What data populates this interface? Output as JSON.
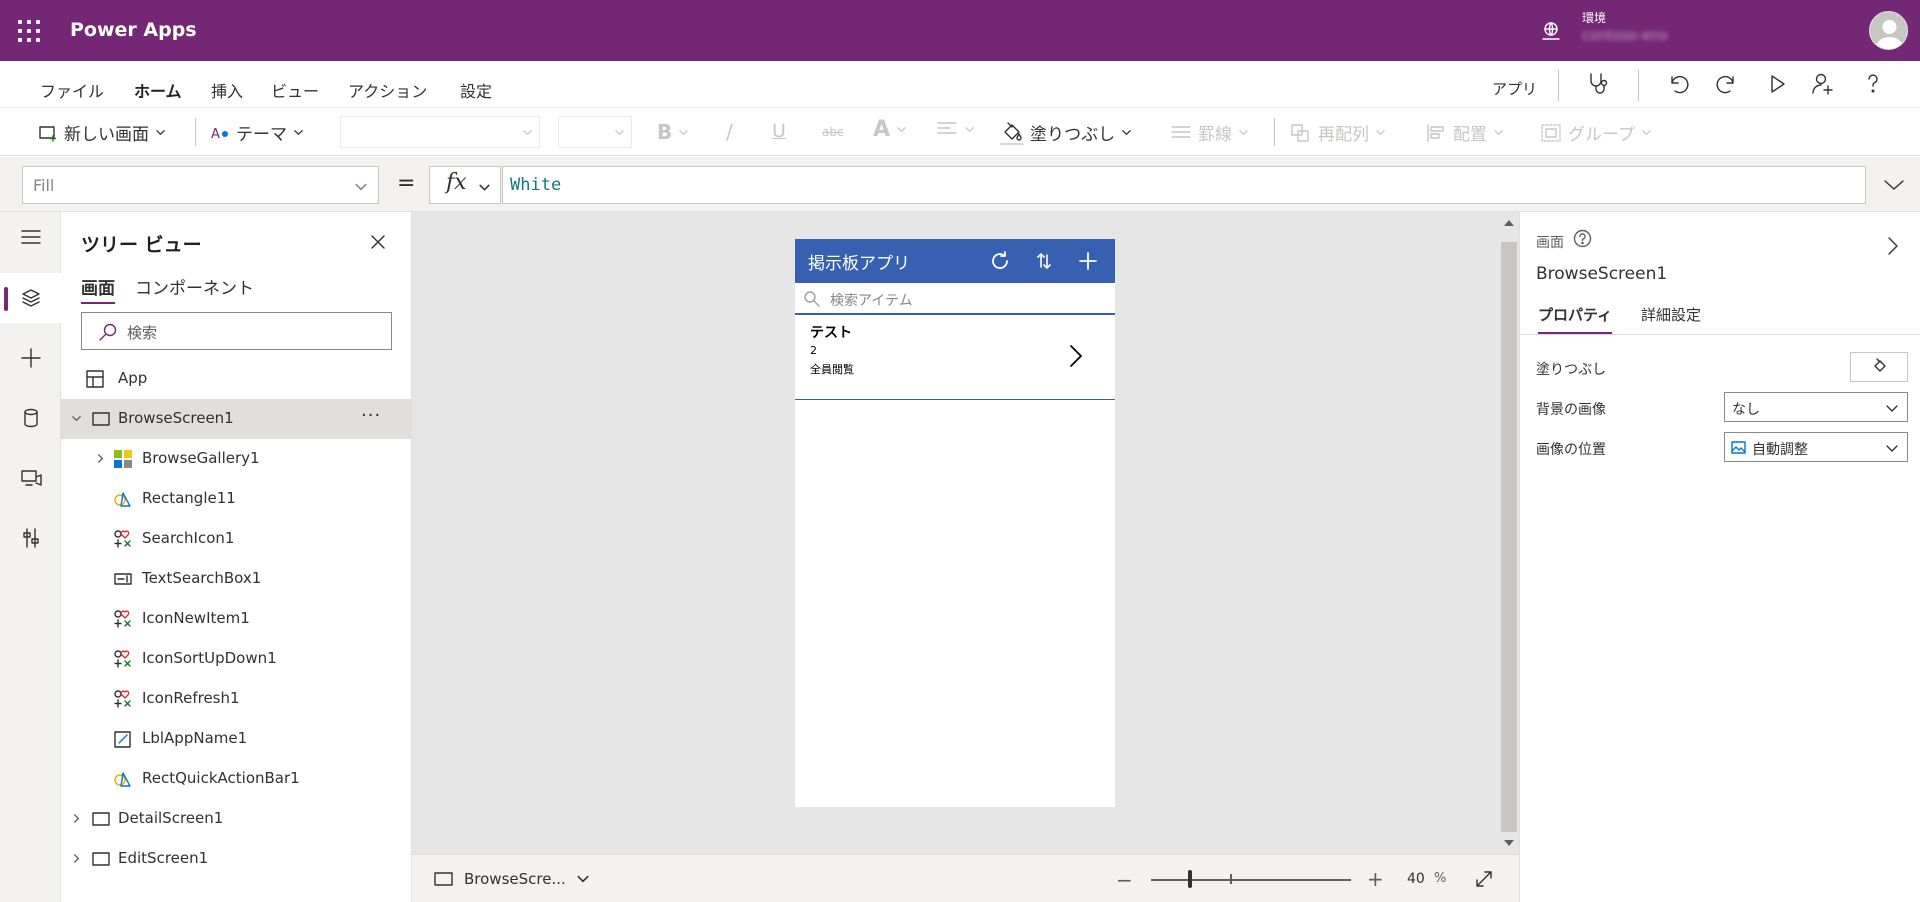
{
  "topbar": {
    "app_title": "Power Apps",
    "environment_label": "環境",
    "environment_value": "contoso-env"
  },
  "menu": {
    "tabs": [
      "ファイル",
      "ホーム",
      "挿入",
      "ビュー",
      "アクション",
      "設定"
    ],
    "active_tab": "ホーム",
    "app_label": "アプリ"
  },
  "ribbon": {
    "new_screen": "新しい画面",
    "theme": "テーマ",
    "bold": "B",
    "italic": "/",
    "underline": "U",
    "strike": "abc",
    "font_color": "A",
    "fill": "塗りつぶし",
    "border": "罫線",
    "reorder": "再配列",
    "align": "配置",
    "group": "グループ"
  },
  "formula": {
    "property": "Fill",
    "equals": "=",
    "fx": "fx",
    "value": "White"
  },
  "tree": {
    "title": "ツリー ビュー",
    "tabs": [
      "画面",
      "コンポーネント"
    ],
    "search_placeholder": "検索",
    "items": [
      {
        "label": "App",
        "icon": "app-icon"
      },
      {
        "label": "BrowseScreen1",
        "icon": "screen-icon",
        "selected": true,
        "more": "···"
      },
      {
        "label": "BrowseGallery1",
        "icon": "gallery-icon"
      },
      {
        "label": "Rectangle11",
        "icon": "shape-icon"
      },
      {
        "label": "SearchIcon1",
        "icon": "icons-icon"
      },
      {
        "label": "TextSearchBox1",
        "icon": "text-input-icon"
      },
      {
        "label": "IconNewItem1",
        "icon": "icons-icon"
      },
      {
        "label": "IconSortUpDown1",
        "icon": "icons-icon"
      },
      {
        "label": "IconRefresh1",
        "icon": "icons-icon"
      },
      {
        "label": "LblAppName1",
        "icon": "label-icon"
      },
      {
        "label": "RectQuickActionBar1",
        "icon": "shape-icon"
      },
      {
        "label": "DetailScreen1",
        "icon": "screen-icon"
      },
      {
        "label": "EditScreen1",
        "icon": "screen-icon"
      }
    ]
  },
  "phone": {
    "title": "掲示板アプリ",
    "search_placeholder": "検索アイテム",
    "item_title": "テスト",
    "item_subtitle": "2",
    "item_body": "全員閲覧",
    "header_color": "#3860b2"
  },
  "statusbar": {
    "screen_name": "BrowseScre...",
    "zoom_minus": "−",
    "zoom_plus": "+",
    "zoom_value": "40",
    "zoom_unit": "%",
    "zoom_level": 40
  },
  "properties": {
    "type_label": "画面",
    "name": "BrowseScreen1",
    "tabs": [
      "プロパティ",
      "詳細設定"
    ],
    "fill_label": "塗りつぶし",
    "bg_image_label": "背景の画像",
    "bg_image_value": "なし",
    "image_position_label": "画像の位置",
    "image_position_value": "自動調整"
  },
  "colors": {
    "brand": "#742774",
    "phone_header": "#3860b2",
    "formula_text": "#0e7a7e"
  }
}
